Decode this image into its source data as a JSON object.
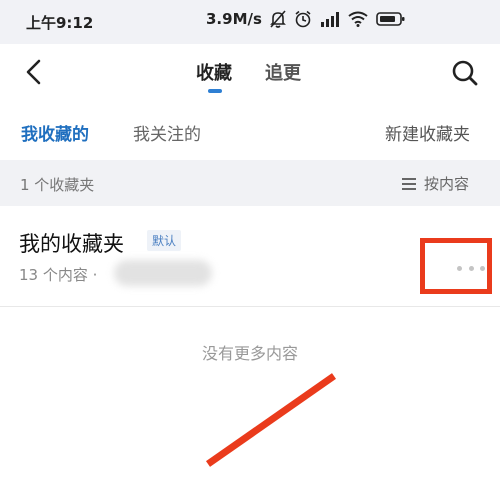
{
  "status_bar": {
    "time": "上午9:12",
    "network_speed": "3.9M/s"
  },
  "nav": {
    "tabs": [
      {
        "label": "收藏",
        "active": true
      },
      {
        "label": "追更",
        "active": false
      }
    ],
    "accent_color": "#2e7fd3"
  },
  "subtabs": {
    "mine": "我收藏的",
    "followed": "我关注的",
    "new_folder": "新建收藏夹"
  },
  "folder_bar": {
    "count_text": "1 个收藏夹",
    "sort_label": "按内容"
  },
  "folders": [
    {
      "name": "我的收藏夹",
      "badge": "默认",
      "meta": "13 个内容 ·"
    }
  ],
  "footer": {
    "no_more": "没有更多内容"
  },
  "annotation_color": "#ea3b1c"
}
